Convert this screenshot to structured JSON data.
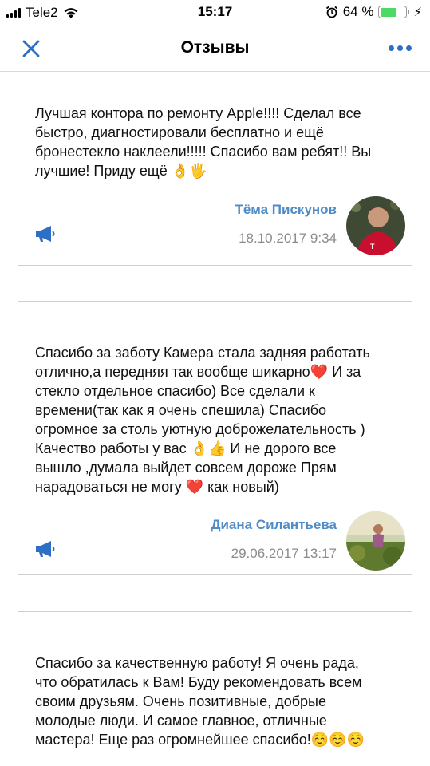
{
  "status_bar": {
    "carrier": "Tele2",
    "time": "15:17",
    "battery_percent": "64 %",
    "battery_level": 0.64
  },
  "nav": {
    "title": "Отзывы"
  },
  "reviews": [
    {
      "text": "Лучшая контора по ремонту Apple!!!! Сделал все\nбыстро, диагностировали бесплатно и ещё\nбронестекло наклеели!!!!! Спасибо вам ребят!! Вы\nлучшие! Приду ещё 👌🖐",
      "author": "Тёма Пискунов",
      "date": "18.10.2017 9:34"
    },
    {
      "text": "Спасибо за заботу Камера стала задняя работать\nотлично,а передняя так вообще шикарно❤️ И за\nстекло отдельное спасибо) Все сделали к\nвремени(так как я очень спешила) Спасибо\nогромное за столь уютную доброжелательность )\nКачество работы у вас 👌👍 И не дорого все\nвышло ,думала выйдет совсем дороже Прям\nнарадоваться не могу ❤️ как новый)",
      "author": "Диана Силантьева",
      "date": "29.06.2017 13:17"
    },
    {
      "text": "Спасибо за качественную работу! Я очень рада,\nчто обратилась к Вам! Буду рекомендовать всем\nсвоим друзьям. Очень позитивные, добрые\nмолодые люди. И самое главное, отличные\nмастера! Еще раз огромнейшее спасибо!☺️☺️☺️"
    }
  ],
  "colors": {
    "accent": "#2c6fc5",
    "author": "#4f8bc6",
    "date": "#8b8b8b",
    "battery": "#4cd964"
  },
  "icons": {
    "close": "close-icon",
    "more": "more-icon",
    "megaphone": "megaphone-icon"
  }
}
